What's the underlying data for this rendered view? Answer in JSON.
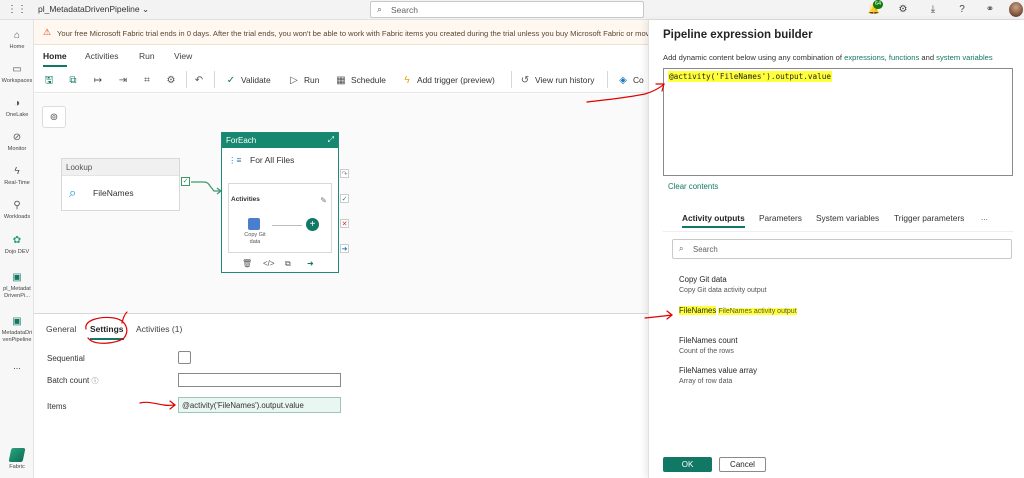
{
  "topbar": {
    "app_name": "pl_MetadataDrivenPipeline",
    "search_placeholder": "Search",
    "notification_count": "64"
  },
  "rail": {
    "items": [
      {
        "label": "Home",
        "icon": "home-icon"
      },
      {
        "label": "Workspaces",
        "icon": "workspaces-icon"
      },
      {
        "label": "OneLake",
        "icon": "onelake-icon"
      },
      {
        "label": "Monitor",
        "icon": "monitor-icon"
      },
      {
        "label": "Real-Time",
        "icon": "real-time-icon"
      },
      {
        "label": "Workloads",
        "icon": "workloads-icon"
      },
      {
        "label": "Dojo DEV",
        "icon": "workspace-icon"
      },
      {
        "label": "pl_Metadat\nDrivenPi...",
        "icon": "pipeline-icon"
      },
      {
        "label": "MetadataDri\nvenPipeline",
        "icon": "pipeline-icon"
      }
    ],
    "more": "...",
    "fabric_label": "Fabric"
  },
  "banner": {
    "text": "Your free Microsoft Fabric trial ends in 0 days. After the trial ends, you won't be able to work with Fabric items you created during the trial unless you buy Microsoft Fabric or move the"
  },
  "menu_tabs": [
    "Home",
    "Activities",
    "Run",
    "View"
  ],
  "toolbar": {
    "validate": "Validate",
    "run": "Run",
    "schedule": "Schedule",
    "add_trigger": "Add trigger (preview)",
    "view_run_history": "View run history",
    "copilot": "Co"
  },
  "canvas": {
    "lookup": {
      "type": "Lookup",
      "name": "FileNames"
    },
    "foreach": {
      "type": "ForEach",
      "name": "For All Files",
      "activities_label": "Activities",
      "inner_activity": "Copy Git data"
    }
  },
  "bottom_panel": {
    "tabs": [
      "General",
      "Settings",
      "Activities (1)"
    ],
    "sequential_label": "Sequential",
    "batch_count_label": "Batch count",
    "items_label": "Items",
    "items_value": "@activity('FileNames').output.value"
  },
  "expression_builder": {
    "title": "Pipeline expression builder",
    "subtitle_prefix": "Add dynamic content below using any combination of ",
    "link_expressions": "expressions",
    "link_functions": "functions",
    "and_text": " and ",
    "link_system_variables": "system variables",
    "expression": "@activity('FileNames').output.value",
    "clear_contents": "Clear contents",
    "tabs": [
      "Activity outputs",
      "Parameters",
      "System variables",
      "Trigger parameters"
    ],
    "tabs_more": "...",
    "search_placeholder": "Search",
    "outputs": [
      {
        "name": "Copy Git data",
        "desc": "Copy Git data activity output"
      },
      {
        "name": "FileNames",
        "desc": "FileNames activity output"
      },
      {
        "name": "FileNames count",
        "desc": "Count of the rows"
      },
      {
        "name": "FileNames value array",
        "desc": "Array of row data"
      }
    ],
    "ok": "OK",
    "cancel": "Cancel"
  },
  "colors": {
    "accent": "#117865",
    "highlight": "#ffff3a",
    "annotation": "#e00000"
  }
}
